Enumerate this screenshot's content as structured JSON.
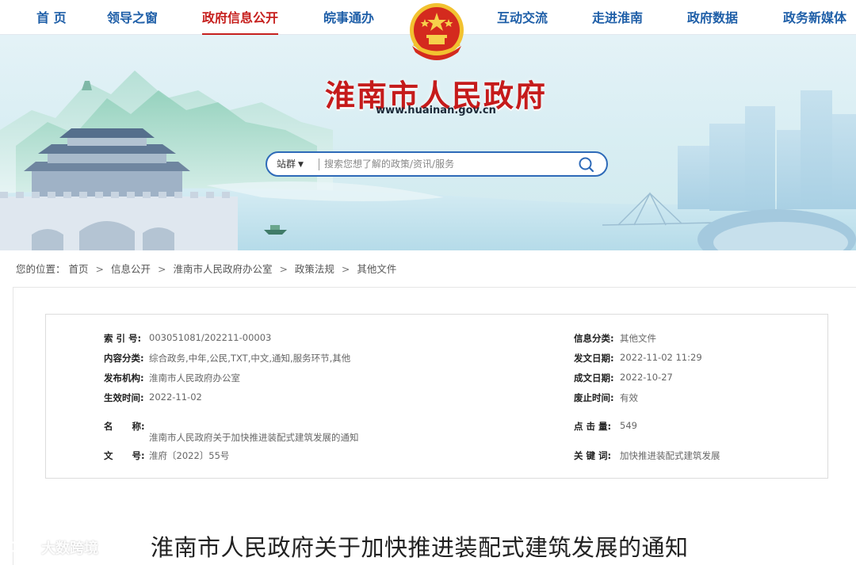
{
  "nav": {
    "items": [
      {
        "label": "首 页"
      },
      {
        "label": "领导之窗"
      },
      {
        "label": "政府信息公开"
      },
      {
        "label": "皖事通办"
      },
      {
        "label": "互动交流"
      },
      {
        "label": "走进淮南"
      },
      {
        "label": "政府数据"
      },
      {
        "label": "政务新媒体"
      }
    ],
    "active_index": 2,
    "active_color": "#c6201e",
    "text_color": "#1f5fa8"
  },
  "header": {
    "site_title": "淮南市人民政府",
    "site_url": "www.huainan.gov.cn",
    "emblem_icon": "national-emblem-icon",
    "title_color": "#c51b1b"
  },
  "search": {
    "scope": "站群",
    "placeholder": "搜索您想了解的政策/资讯/服务",
    "value": "",
    "button_icon": "search-icon",
    "border_color": "#2e6ab8"
  },
  "breadcrumb": {
    "prefix": "您的位置：",
    "items": [
      "首页",
      "信息公开",
      "淮南市人民政府办公室",
      "政策法规",
      "其他文件"
    ],
    "separator": ">"
  },
  "meta": {
    "index_no": {
      "label": "索 引 号:",
      "value": "003051081/202211-00003"
    },
    "category": {
      "label": "信息分类:",
      "value": "其他文件"
    },
    "content_class": {
      "label": "内容分类:",
      "value": "综合政务,中年,公民,TXT,中文,通知,服务环节,其他"
    },
    "issue_date": {
      "label": "发文日期:",
      "value": "2022-11-02 11:29"
    },
    "publisher": {
      "label": "发布机构:",
      "value": "淮南市人民政府办公室"
    },
    "created_date": {
      "label": "成文日期:",
      "value": "2022-10-27"
    },
    "effective_date": {
      "label": "生效时间:",
      "value": "2022-11-02"
    },
    "repeal": {
      "label": "废止时间:",
      "value": "有效"
    },
    "name": {
      "label": "名      称:",
      "value": "淮南市人民政府关于加快推进装配式建筑发展的通知"
    },
    "clicks": {
      "label": "点 击 量:",
      "value": "549"
    },
    "doc_no": {
      "label": "文      号:",
      "value": "淮府〔2022〕55号"
    },
    "keywords": {
      "label": "关 键 词:",
      "value": "加快推进装配式建筑发展"
    }
  },
  "document": {
    "title": "淮南市人民政府关于加快推进装配式建筑发展的通知"
  },
  "watermark": {
    "text": "大数跨境",
    "icon": "weibo-logo-icon"
  }
}
